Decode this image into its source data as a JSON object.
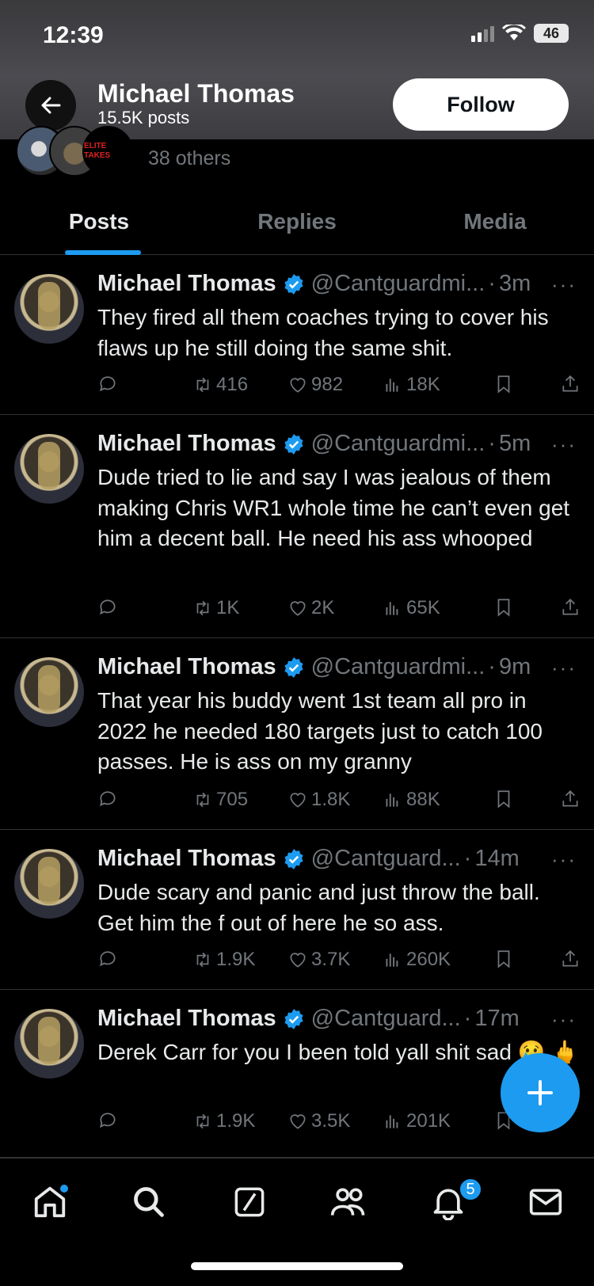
{
  "status_bar": {
    "time": "12:39",
    "battery": "46"
  },
  "header": {
    "name": "Michael Thomas",
    "posts_count": "15.5K posts",
    "follow_label": "Follow"
  },
  "followers_strip": {
    "avatar3_text": "ELITE TAKES",
    "text": "38 others"
  },
  "tabs": [
    {
      "label": "Posts",
      "active": true
    },
    {
      "label": "Replies",
      "active": false
    },
    {
      "label": "Media",
      "active": false
    }
  ],
  "posts": [
    {
      "name": "Michael Thomas",
      "handle": "@Cantguardmi...",
      "time": "3m",
      "text": "They fired all them coaches trying to cover his flaws up he still doing the same shit.",
      "retweets": "416",
      "likes": "982",
      "views": "18K"
    },
    {
      "name": "Michael Thomas",
      "handle": "@Cantguardmi...",
      "time": "5m",
      "text": "Dude tried to lie and say I was jealous of them making Chris WR1 whole time he can’t even get him a decent ball. He need his ass whooped",
      "retweets": "1K",
      "likes": "2K",
      "views": "65K"
    },
    {
      "name": "Michael Thomas",
      "handle": "@Cantguardmi...",
      "time": "9m",
      "text": "That year his buddy went 1st team all pro  in 2022 he needed 180 targets just to catch 100 passes. He is ass on my granny",
      "retweets": "705",
      "likes": "1.8K",
      "views": "88K"
    },
    {
      "name": "Michael Thomas",
      "handle": "@Cantguard...",
      "time": "14m",
      "text": "Dude scary and panic and just throw the ball. Get him the f out of here he so ass.",
      "retweets": "1.9K",
      "likes": "3.7K",
      "views": "260K"
    },
    {
      "name": "Michael Thomas",
      "handle": "@Cantguard...",
      "time": "17m",
      "text": "Derek Carr for you I been told yall shit sad 😢 🖕",
      "retweets": "1.9K",
      "likes": "3.5K",
      "views": "201K"
    }
  ],
  "separator": "·",
  "more": "···",
  "nav": {
    "notifications_badge": "5"
  },
  "colors": {
    "accent": "#1d9bf0",
    "muted": "#71767b",
    "background": "#000000"
  }
}
